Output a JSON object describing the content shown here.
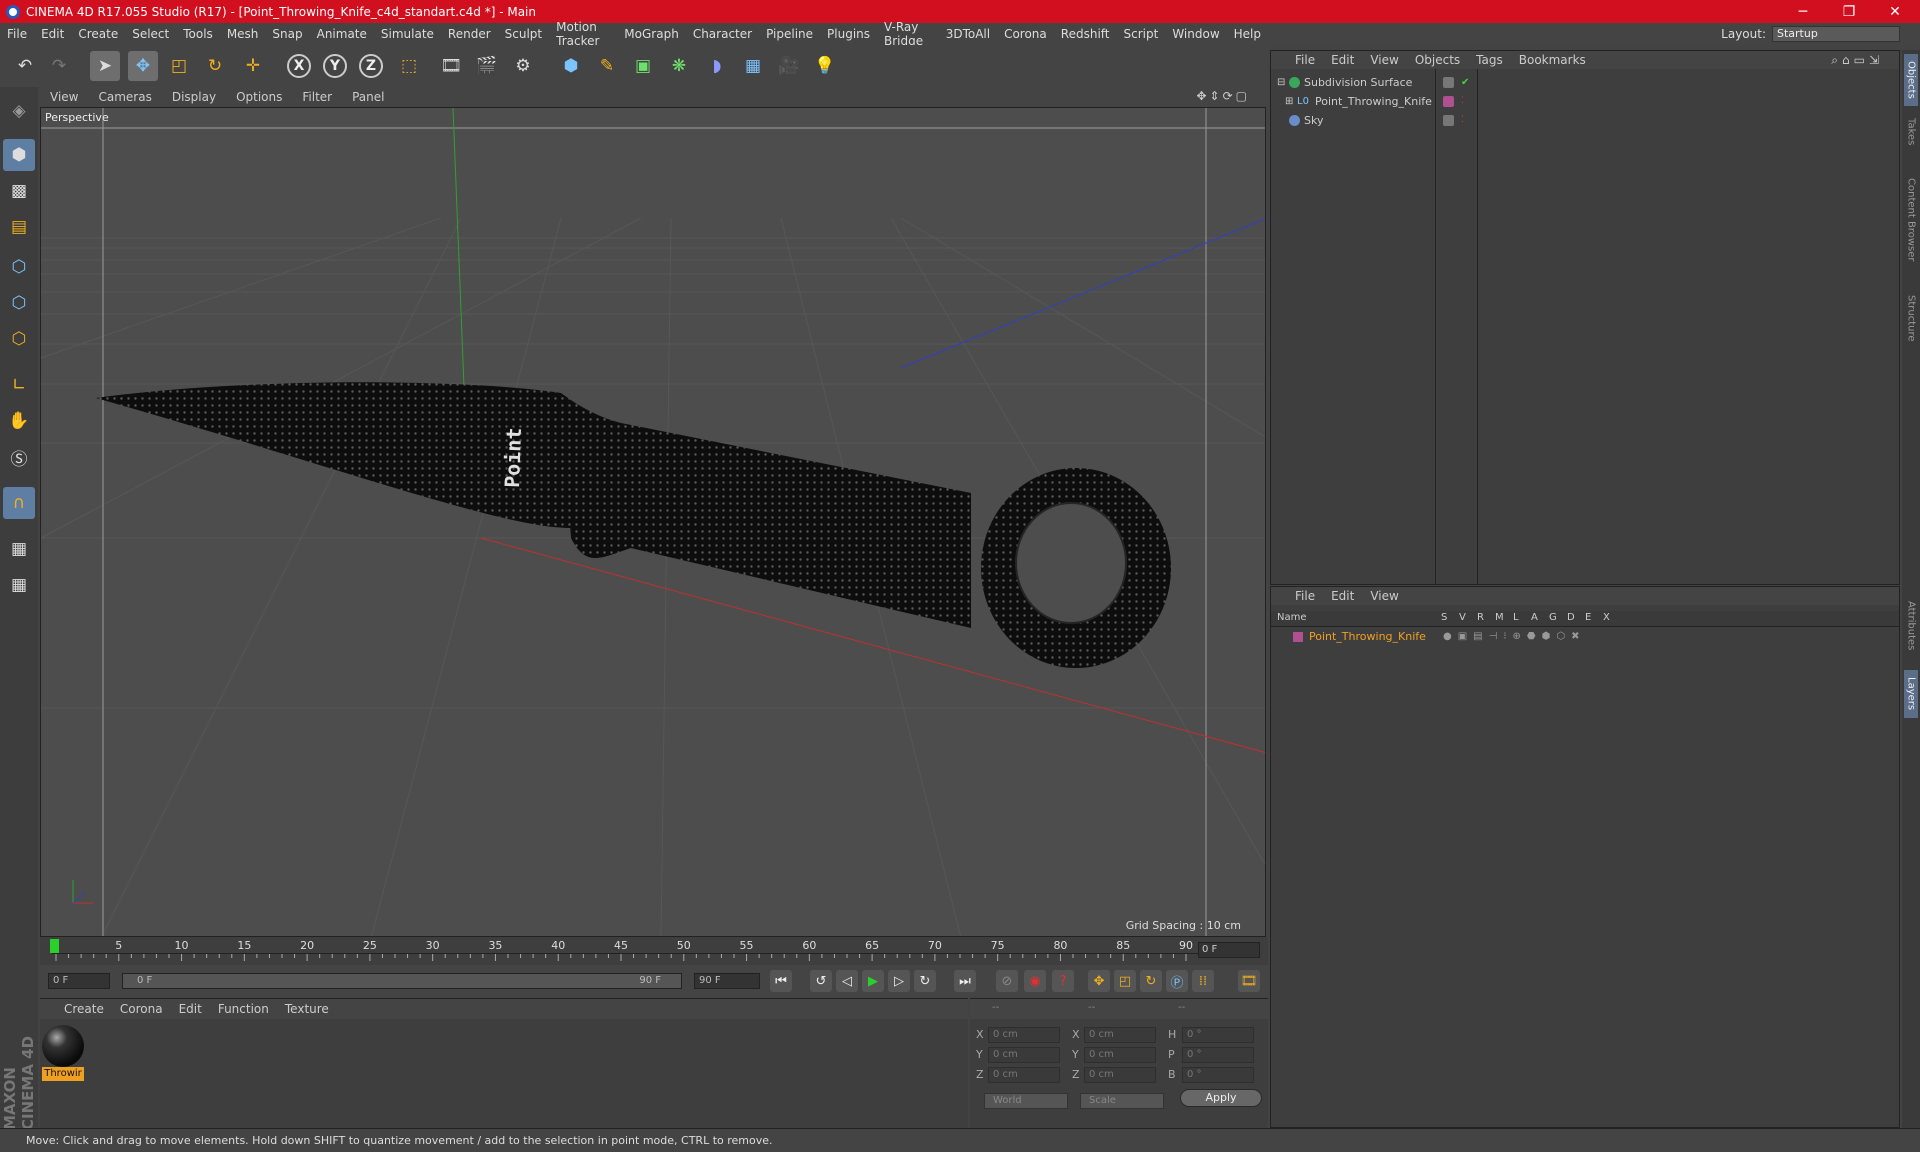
{
  "window": {
    "title": "CINEMA 4D R17.055 Studio (R17) - [Point_Throwing_Knife_c4d_standart.c4d *] - Main",
    "minimize_glyph": "─",
    "maximize_glyph": "❐",
    "close_glyph": "✕"
  },
  "menubar": [
    "File",
    "Edit",
    "Create",
    "Select",
    "Tools",
    "Mesh",
    "Snap",
    "Animate",
    "Simulate",
    "Render",
    "Sculpt",
    "Motion Tracker",
    "MoGraph",
    "Character",
    "Pipeline",
    "Plugins",
    "V-Ray Bridge",
    "3DToAll",
    "Corona",
    "Redshift",
    "Script",
    "Window",
    "Help"
  ],
  "layout": {
    "label": "Layout:",
    "value": "Startup"
  },
  "axis_buttons": {
    "x": "X",
    "y": "Y",
    "z": "Z"
  },
  "viewport": {
    "menu": [
      "View",
      "Cameras",
      "Display",
      "Options",
      "Filter",
      "Panel"
    ],
    "camera_label": "Perspective",
    "grid_spacing": "Grid Spacing : 10 cm",
    "knife_text": "Point"
  },
  "timeline": {
    "ticks": [
      "0",
      "5",
      "10",
      "15",
      "20",
      "25",
      "30",
      "35",
      "40",
      "45",
      "50",
      "55",
      "60",
      "65",
      "70",
      "75",
      "80",
      "85",
      "90"
    ],
    "current_frame": "0 F"
  },
  "transport": {
    "start_field": "0 F",
    "range_start": "0 F",
    "range_end": "90 F",
    "end_field": "90 F"
  },
  "material_manager": {
    "menu": [
      "Create",
      "Corona",
      "Edit",
      "Function",
      "Texture"
    ],
    "material_label": "Throwir"
  },
  "coordinates": {
    "header": [
      "--",
      "--",
      "--"
    ],
    "rows": [
      {
        "a": "X",
        "av": "0 cm",
        "b": "X",
        "bv": "0 cm",
        "c": "H",
        "cv": "0 °"
      },
      {
        "a": "Y",
        "av": "0 cm",
        "b": "Y",
        "bv": "0 cm",
        "c": "P",
        "cv": "0 °"
      },
      {
        "a": "Z",
        "av": "0 cm",
        "b": "Z",
        "bv": "0 cm",
        "c": "B",
        "cv": "0 °"
      }
    ],
    "space_dropdown": "World",
    "mode_dropdown": "Scale",
    "apply": "Apply"
  },
  "status": "Move: Click and drag to move elements. Hold down SHIFT to quantize movement / add to the selection in point mode, CTRL to remove.",
  "object_manager": {
    "menu": [
      "File",
      "Edit",
      "View",
      "Objects",
      "Tags",
      "Bookmarks"
    ],
    "objects": [
      {
        "name": "Subdivision Surface"
      },
      {
        "name": "Point_Throwing_Knife"
      },
      {
        "name": "Sky"
      }
    ]
  },
  "layer_manager": {
    "menu": [
      "File",
      "Edit",
      "View"
    ],
    "columns": [
      "Name",
      "S",
      "V",
      "R",
      "M",
      "L",
      "A",
      "G",
      "D",
      "E",
      "X"
    ],
    "layer_name": "Point_Throwing_Knife"
  },
  "right_tabs": [
    "Objects",
    "Takes",
    "Content Browser",
    "Structure",
    "Attributes",
    "Layers"
  ],
  "brand": "MAXON CINEMA 4D",
  "colors": {
    "title_bar": "#d10f1f",
    "layer_name": "#f0a020",
    "x_axis": "#c03030",
    "y_axis": "#30a030",
    "z_axis": "#3040c0"
  }
}
